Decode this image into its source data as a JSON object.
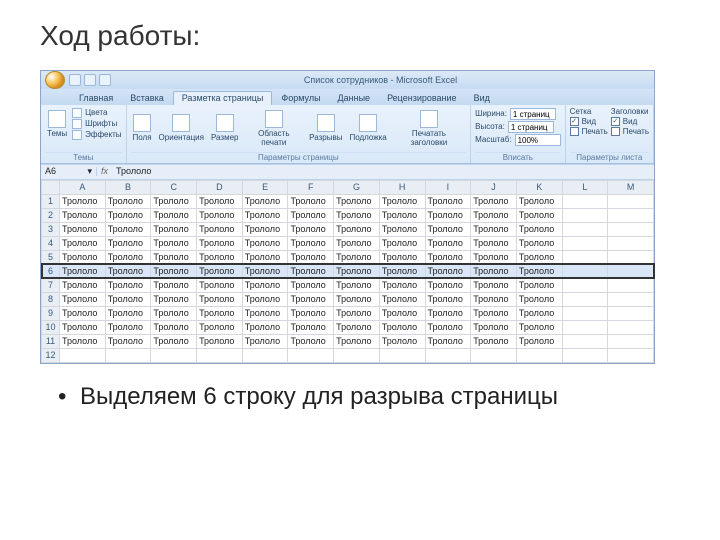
{
  "slide": {
    "title": "Ход работы:",
    "bullet": "Выделяем 6 строку для разрыва страницы"
  },
  "titlebar": {
    "doc_title": "Список сотрудников - Microsoft Excel"
  },
  "tabs": {
    "home": "Главная",
    "insert": "Вставка",
    "layout": "Разметка страницы",
    "formulas": "Формулы",
    "data": "Данные",
    "review": "Рецензирование",
    "view": "Вид"
  },
  "ribbon": {
    "themes": {
      "label": "Темы",
      "themes_btn": "Темы",
      "colors": "Цвета",
      "fonts": "Шрифты",
      "effects": "Эффекты"
    },
    "page_setup": {
      "label": "Параметры страницы",
      "margins": "Поля",
      "orientation": "Ориентация",
      "size": "Размер",
      "print_area": "Область печати",
      "breaks": "Разрывы",
      "background": "Подложка",
      "print_titles": "Печатать заголовки"
    },
    "scale": {
      "label": "Вписать",
      "width_lbl": "Ширина:",
      "width_val": "1 страниц",
      "height_lbl": "Высота:",
      "height_val": "1 страниц",
      "scale_lbl": "Масштаб:",
      "scale_val": "100%"
    },
    "sheet_opts": {
      "label": "Параметры листа",
      "gridlines": "Сетка",
      "headings": "Заголовки",
      "view": "Вид",
      "print": "Печать"
    }
  },
  "formula_bar": {
    "name_box": "A6",
    "value": "Трололо"
  },
  "columns": [
    "A",
    "B",
    "C",
    "D",
    "E",
    "F",
    "G",
    "H",
    "I",
    "J",
    "K",
    "L",
    "M"
  ],
  "row_numbers": [
    "1",
    "2",
    "3",
    "4",
    "5",
    "6",
    "7",
    "8",
    "9",
    "10",
    "11",
    "12"
  ],
  "cell_value": "Трололо",
  "selected_row_index": 5,
  "filled_cols": 11
}
